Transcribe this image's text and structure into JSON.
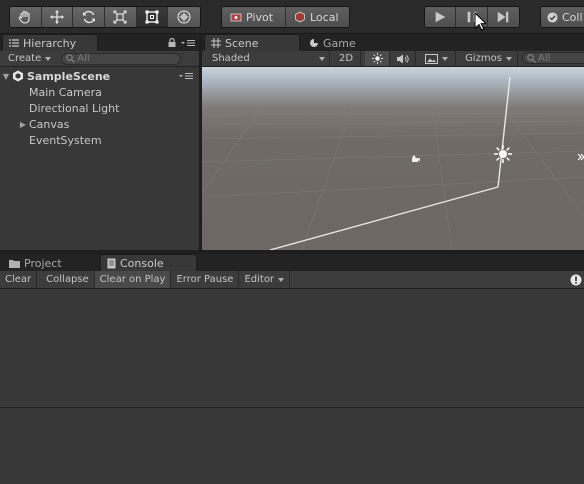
{
  "toolbar": {
    "tools": [
      {
        "name": "hand-tool",
        "icon": "hand-icon"
      },
      {
        "name": "move-tool",
        "icon": "move-arrows-icon"
      },
      {
        "name": "rotate-tool",
        "icon": "rotate-icon"
      },
      {
        "name": "scale-tool",
        "icon": "scale-icon"
      },
      {
        "name": "rect-tool",
        "icon": "rect-transform-icon"
      },
      {
        "name": "transform-tool",
        "icon": "transform-icon"
      }
    ],
    "pivot_label": "Pivot",
    "local_label": "Local",
    "collab_label": "Coll"
  },
  "hierarchy": {
    "tab_label": "Hierarchy",
    "create_label": "Create",
    "search_placeholder": "All",
    "scene_name": "SampleScene",
    "items": [
      {
        "label": "Main Camera",
        "expandable": false
      },
      {
        "label": "Directional Light",
        "expandable": false
      },
      {
        "label": "Canvas",
        "expandable": true
      },
      {
        "label": "EventSystem",
        "expandable": false
      }
    ]
  },
  "scene": {
    "tab_scene": "Scene",
    "tab_game": "Game",
    "shading_mode": "Shaded",
    "mode_2d": "2D",
    "gizmos_label": "Gizmos",
    "search_placeholder": "All"
  },
  "console": {
    "tab_project": "Project",
    "tab_console": "Console",
    "buttons": {
      "clear": "Clear",
      "collapse": "Collapse",
      "clear_on_play": "Clear on Play",
      "error_pause": "Error Pause",
      "editor": "Editor"
    }
  },
  "colors": {
    "background": "#282828",
    "panel": "#383838",
    "accent_text": "#c4c4c4"
  }
}
